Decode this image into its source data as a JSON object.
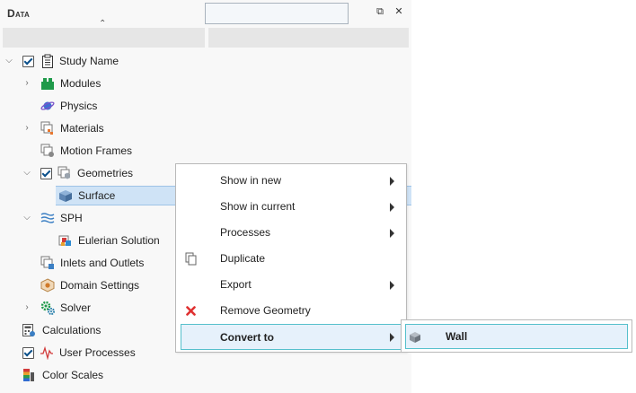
{
  "panel": {
    "title": "Data",
    "search_value": "",
    "restore_glyph": "⧉",
    "close_glyph": "✕",
    "sort_glyph": "⌃"
  },
  "tree": {
    "study": "Study Name",
    "modules": "Modules",
    "physics": "Physics",
    "materials": "Materials",
    "motion_frames": "Motion Frames",
    "geometries": "Geometries",
    "surface": "Surface",
    "sph": "SPH",
    "eulerian": "Eulerian Solution",
    "inlets": "Inlets and Outlets",
    "domain_settings": "Domain Settings",
    "solver": "Solver",
    "calculations": "Calculations",
    "user_processes": "User Processes",
    "color_scales": "Color Scales"
  },
  "context_menu": {
    "show_in_new": "Show in new",
    "show_in_current": "Show in current",
    "processes": "Processes",
    "duplicate": "Duplicate",
    "export": "Export",
    "remove_geometry": "Remove Geometry",
    "convert_to": "Convert to"
  },
  "submenu": {
    "wall": "Wall"
  },
  "colors": {
    "selection": "#cfe3f6",
    "menu_highlight_border": "#56c0cc",
    "remove_icon": "#e03030"
  }
}
